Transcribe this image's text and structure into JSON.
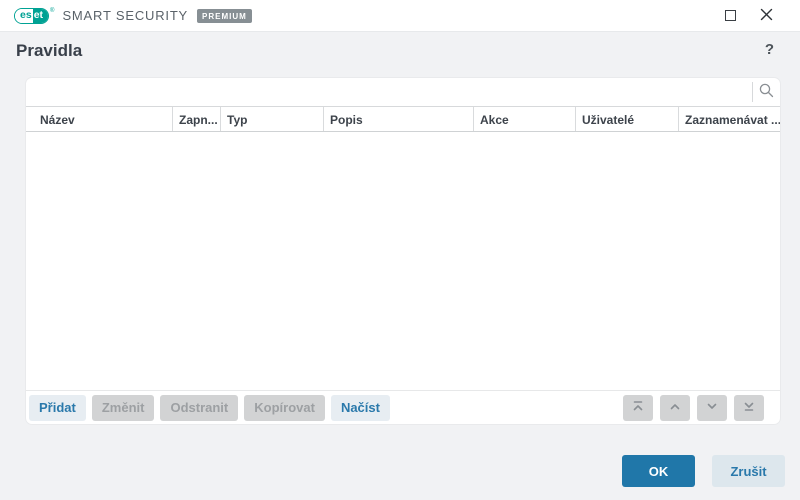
{
  "titlebar": {
    "logo_es": "es",
    "logo_et": "et",
    "registered_mark": "®",
    "product": "SMART SECURITY",
    "edition": "PREMIUM"
  },
  "window_controls": {
    "maximize_icon": "maximize-square",
    "close_icon": "close-x"
  },
  "header": {
    "title": "Pravidla",
    "help": "?"
  },
  "search": {
    "value": "",
    "placeholder": "",
    "icon": "magnifier"
  },
  "table": {
    "columns": [
      "Název",
      "Zapn...",
      "Typ",
      "Popis",
      "Akce",
      "Uživatelé",
      "Zaznamenávat ..."
    ],
    "rows": []
  },
  "toolbar": {
    "buttons": [
      {
        "label": "Přidat",
        "enabled": true
      },
      {
        "label": "Změnit",
        "enabled": false
      },
      {
        "label": "Odstranit",
        "enabled": false
      },
      {
        "label": "Kopírovat",
        "enabled": false
      },
      {
        "label": "Načíst",
        "enabled": true
      }
    ],
    "reorder_icons": [
      "move-to-top",
      "move-up",
      "move-down",
      "move-to-bottom"
    ],
    "reorder_enabled": false
  },
  "dialog_buttons": {
    "ok": "OK",
    "cancel": "Zrušit"
  },
  "colors": {
    "brand_teal": "#00a294",
    "primary_blue": "#2077a9",
    "link_blue": "#2a79ab",
    "background": "#f1f2f4",
    "disabled_bg": "#d2d3d4",
    "disabled_text": "#9da0a3"
  }
}
